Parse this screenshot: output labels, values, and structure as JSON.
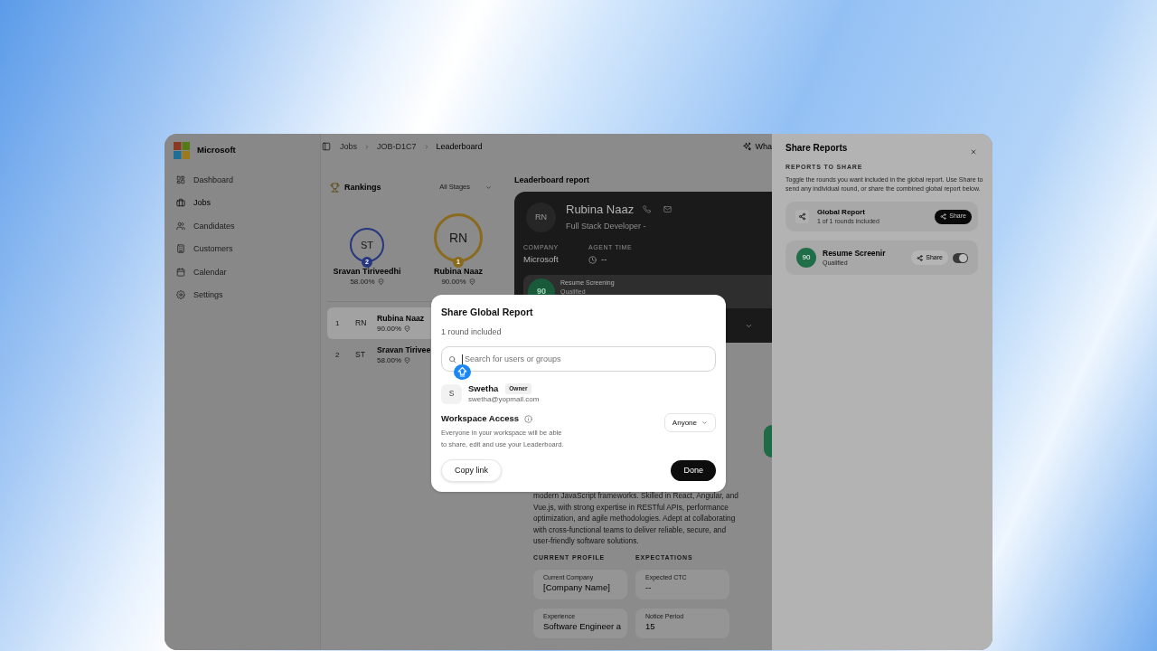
{
  "sidebar": {
    "brand": "Microsoft",
    "items": [
      {
        "label": "Dashboard",
        "selected": false
      },
      {
        "label": "Jobs",
        "selected": true
      },
      {
        "label": "Candidates",
        "selected": false
      },
      {
        "label": "Customers",
        "selected": false
      },
      {
        "label": "Calendar",
        "selected": false
      },
      {
        "label": "Settings",
        "selected": false
      }
    ]
  },
  "breadcrumb": [
    {
      "label": "Jobs"
    },
    {
      "label": "JOB-D1C7"
    },
    {
      "label": "Leaderboard"
    }
  ],
  "header_action": {
    "label": "Wha"
  },
  "rankings": {
    "title": "Rankings",
    "stage_filter": "All Stages",
    "podium": [
      {
        "initials": "ST",
        "rank": "2",
        "name": "Sravan Tiriveedhi",
        "score": "58.00%",
        "color": "#26367f",
        "kind": "runner_up"
      },
      {
        "initials": "RN",
        "rank": "1",
        "name": "Rubina Naaz",
        "score": "90.00%",
        "color": "#8a6a1c",
        "kind": "winner"
      }
    ],
    "list": [
      {
        "rank": "1",
        "initials": "RN",
        "name": "Rubina Naaz",
        "score": "90.00%",
        "selected": true
      },
      {
        "rank": "2",
        "initials": "ST",
        "name": "Sravan Tirivee",
        "score": "58.00%",
        "selected": false
      }
    ]
  },
  "report": {
    "title": "Leaderboard report",
    "candidate": {
      "initials": "RN",
      "name": "Rubina Naaz",
      "role": "Full Stack Developer -"
    },
    "fields": [
      {
        "label": "COMPANY",
        "value": "Microsoft",
        "kind": "text"
      },
      {
        "label": "AGENT TIME",
        "value": "--",
        "kind": "time"
      }
    ],
    "rounds": [
      {
        "score": "90",
        "name": "Resume Screening",
        "status": "Qualified"
      }
    ],
    "summary": "modern JavaScript frameworks. Skilled in React, Angular, and Vue.js, with strong expertise in RESTful APIs, performance optimization, and agile methodologies. Adept at collaborating with cross-functional teams to deliver reliable, secure, and user-friendly software solutions.",
    "sections": [
      {
        "title": "CURRENT PROFILE",
        "items": [
          {
            "label": "Current Company",
            "value": "[Company Name]"
          },
          {
            "label": "Experience",
            "value": "Software Engineer a"
          }
        ]
      },
      {
        "title": "EXPECTATIONS",
        "items": [
          {
            "label": "Expected CTC",
            "value": "--"
          },
          {
            "label": "Notice Period",
            "value": "15"
          }
        ]
      }
    ]
  },
  "share_panel": {
    "title": "Share Reports",
    "section_label": "REPORTS TO SHARE",
    "description": "Toggle the rounds you want included in the global report. Use Share to send any individual round, or share the combined global report below.",
    "global_report": {
      "title": "Global Report",
      "subtitle": "1 of 1 rounds included",
      "share": "Share"
    },
    "rounds": [
      {
        "score": "90",
        "name": "Resume Screenir",
        "status": "Qualified",
        "share": "Share",
        "on": true
      }
    ]
  },
  "modal": {
    "title": "Share Global Report",
    "subtitle": "1 round included",
    "search": {
      "placeholder": "Search for users or groups"
    },
    "members": [
      {
        "initial": "S",
        "name": "Swetha",
        "role": "Owner",
        "email": "swetha@yopmail.com"
      }
    ],
    "workspace_access": {
      "title": "Workspace Access",
      "description": "Everyone in your workspace will be able to share, edit and use your Leaderboard.",
      "access": "Anyone"
    },
    "buttons": [
      {
        "label": "Copy link",
        "kind": "secondary"
      },
      {
        "label": "Done",
        "kind": "primary"
      }
    ]
  }
}
